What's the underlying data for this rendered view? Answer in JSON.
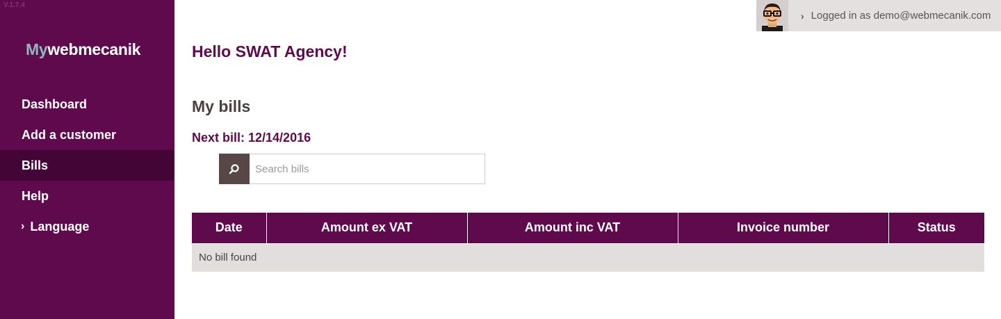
{
  "app": {
    "version": "V.1.7.4",
    "logo_my": "My",
    "logo_brand": "webmecanik"
  },
  "user": {
    "login_text": "Logged in as demo@webmecanik.com"
  },
  "sidebar": {
    "items": [
      {
        "label": "Dashboard"
      },
      {
        "label": "Add a customer"
      },
      {
        "label": "Bills"
      },
      {
        "label": "Help"
      },
      {
        "label": "Language"
      }
    ]
  },
  "main": {
    "greeting": "Hello SWAT Agency!",
    "section_title": "My bills",
    "next_bill": "Next bill: 12/14/2016",
    "search_placeholder": "Search bills",
    "table": {
      "headers": [
        "Date",
        "Amount ex VAT",
        "Amount inc VAT",
        "Invoice number",
        "Status"
      ],
      "empty_message": "No bill found"
    }
  },
  "colors": {
    "brand": "#5e0a4d",
    "sidebar_active": "#420535",
    "logo_accent": "#8fb8bd",
    "search_button": "#574747"
  }
}
